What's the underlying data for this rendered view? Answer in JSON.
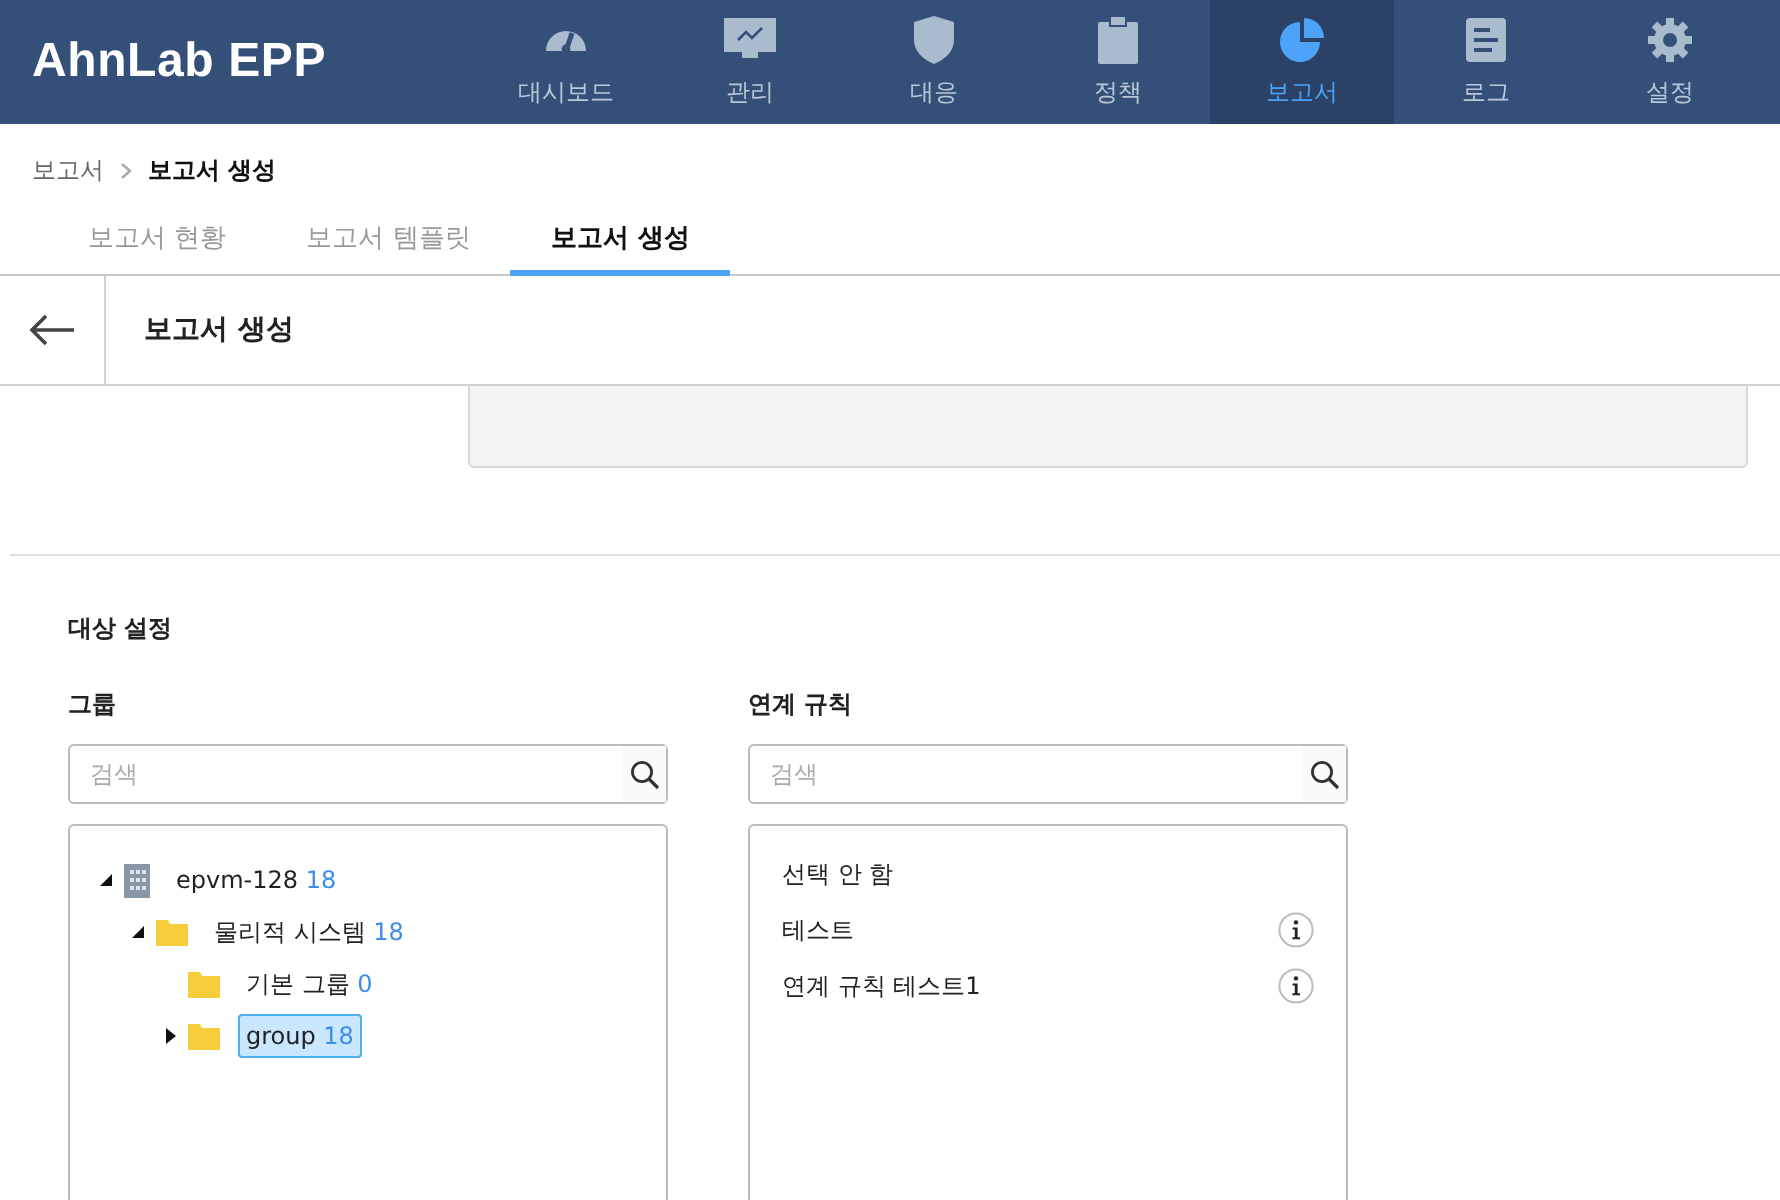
{
  "header": {
    "logo": "AhnLab EPP",
    "nav": [
      {
        "label": "대시보드",
        "kind": "gauge",
        "selected": false
      },
      {
        "label": "관리",
        "kind": "monitor",
        "selected": false
      },
      {
        "label": "대응",
        "kind": "shield",
        "selected": false
      },
      {
        "label": "정책",
        "kind": "clipboard",
        "selected": false
      },
      {
        "label": "보고서",
        "kind": "pie",
        "selected": true
      },
      {
        "label": "로그",
        "kind": "document",
        "selected": false
      },
      {
        "label": "설정",
        "kind": "gear",
        "selected": false
      }
    ]
  },
  "breadcrumb": [
    "보고서",
    "보고서 생성"
  ],
  "tabs": [
    {
      "label": "보고서 현황",
      "selected": false
    },
    {
      "label": "보고서 템플릿",
      "selected": false
    },
    {
      "label": "보고서 생성",
      "selected": true
    }
  ],
  "page_title": "보고서 생성",
  "section_title": "대상 설정",
  "group": {
    "label": "그룹",
    "search": {
      "placeholder": "검색"
    },
    "tree": [
      {
        "label": "epvm-128",
        "count": "18",
        "kind": "building",
        "expanded": true,
        "selected": false,
        "children": [
          {
            "label": "물리적 시스템",
            "count": "18",
            "kind": "folder",
            "expanded": true,
            "selected": false,
            "children": [
              {
                "label": "기본 그룹",
                "count": "0",
                "kind": "folder",
                "selected": false
              },
              {
                "label": "group",
                "count": "18",
                "kind": "folder",
                "expanded": false,
                "selected": true
              }
            ]
          }
        ]
      }
    ]
  },
  "rules": {
    "label": "연계 규칙",
    "search": {
      "placeholder": "검색"
    },
    "items": [
      {
        "label": "선택 안 함",
        "info": false
      },
      {
        "label": "테스트",
        "info": true
      },
      {
        "label": "연계 규칙 테스트1",
        "info": true
      }
    ]
  }
}
